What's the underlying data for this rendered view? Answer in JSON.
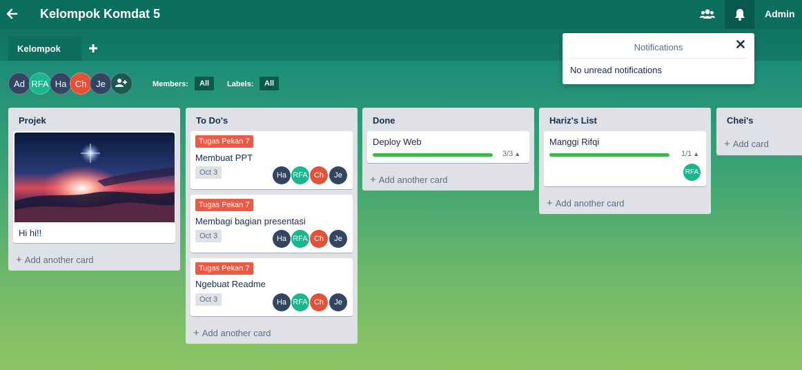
{
  "header": {
    "board_title": "Kelompok Komdat 5",
    "user": "Admin",
    "icons": [
      "back-arrow-icon",
      "members-icon",
      "bell-icon"
    ]
  },
  "tabs": {
    "active": "Kelompok",
    "add_icon": "plus-icon"
  },
  "members": [
    "Ad",
    "RFA",
    "Ha",
    "Ch",
    "Je"
  ],
  "filters": {
    "members_label": "Members:",
    "members_value": "All",
    "labels_label": "Labels:",
    "labels_value": "All"
  },
  "notifications": {
    "title": "Notifications",
    "empty_text": "No unread notifications",
    "close_icon": "close-icon"
  },
  "lists": [
    {
      "title": "Projek",
      "cards": [
        {
          "title": "Hi hi!!",
          "has_image": true
        }
      ],
      "add_label": "Add another card"
    },
    {
      "title": "To Do's",
      "cards": [
        {
          "label": "Tugas Pekan 7",
          "title": "Membuat PPT",
          "date": "Oct 3",
          "members": [
            "Ha",
            "RFA",
            "Ch",
            "Je"
          ]
        },
        {
          "label": "Tugas Pekan 7",
          "title": "Membagi bagian presentasi",
          "date": "Oct 3",
          "members": [
            "Ha",
            "RFA",
            "Ch",
            "Je"
          ]
        },
        {
          "label": "Tugas Pekan 7",
          "title": "Ngebuat Readme",
          "date": "Oct 3",
          "members": [
            "Ha",
            "RFA",
            "Ch",
            "Je"
          ]
        }
      ],
      "add_label": "Add another card"
    },
    {
      "title": "Done",
      "cards": [
        {
          "title": "Deploy Web",
          "progress_text": "3/3",
          "progress": 1.0
        }
      ],
      "add_label": "Add another card"
    },
    {
      "title": "Hariz's List",
      "cards": [
        {
          "title": "Manggi Rifqi",
          "progress_text": "1/1",
          "progress": 1.0,
          "members": [
            "RFA"
          ]
        }
      ],
      "add_label": "Add another card"
    },
    {
      "title": "Chei's",
      "cards": [],
      "add_label": "Add card"
    }
  ],
  "colors": {
    "topbar": "#0b6e5e",
    "label_red": "#eb5a46",
    "progress_green": "#3cb74d",
    "avatar_dark": "#344563",
    "avatar_teal": "#1bb58f",
    "avatar_red": "#e0533a"
  }
}
